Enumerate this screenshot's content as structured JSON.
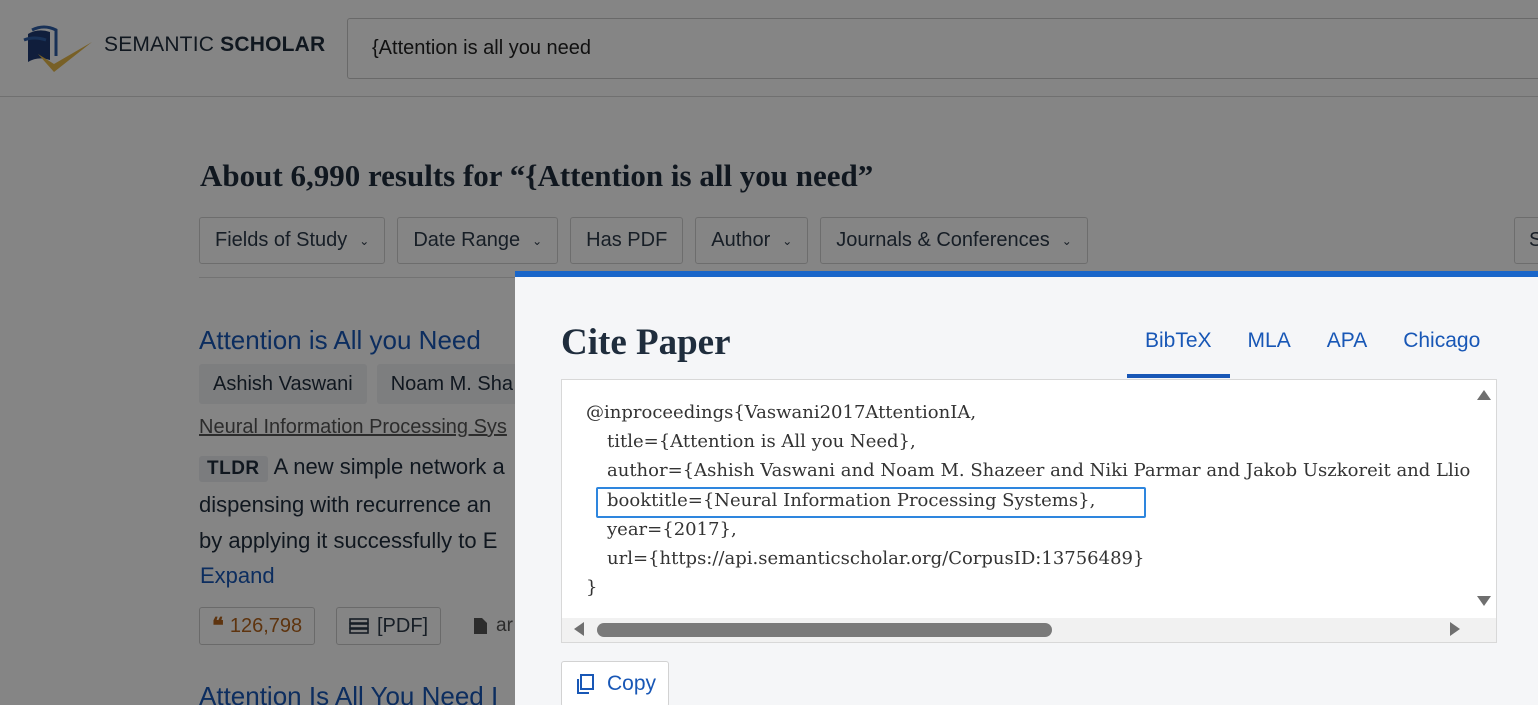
{
  "header": {
    "logo_text_light": "SEMANTIC ",
    "logo_text_bold": "SCHOLAR",
    "search_value": "{Attention is all you need"
  },
  "results": {
    "heading": "About 6,990 results for “{Attention is all you need”",
    "filters": {
      "fields_of_study": "Fields of Study",
      "date_range": "Date Range",
      "has_pdf": "Has PDF",
      "author": "Author",
      "journals": "Journals & Conferences",
      "partial_right": "S"
    },
    "paper1": {
      "title": "Attention is All you Need",
      "author1": "Ashish Vaswani",
      "author2": "Noam M. Sha",
      "venue": "Neural Information Processing Sys",
      "tldr_badge": "TLDR",
      "tldr_line1": "A new simple network a",
      "tldr_line2": "dispensing with recurrence an",
      "tldr_line3": "by applying it successfully to E",
      "expand": "Expand",
      "citations": "126,798",
      "pdf_label": "[PDF]",
      "arxiv_partial": "ar"
    },
    "paper2": {
      "title": "Attention Is All You Need I"
    }
  },
  "modal": {
    "title": "Cite Paper",
    "tabs": {
      "bibtex": "BibTeX",
      "mla": "MLA",
      "apa": "APA",
      "chicago": "Chicago"
    },
    "active_tab": "BibTeX",
    "bibtex_lines": {
      "l1": "@inproceedings{Vaswani2017AttentionIA,",
      "l2": "title={Attention is All you Need},",
      "l3": "author={Ashish Vaswani and Noam M. Shazeer and Niki Parmar and Jakob Uszkoreit and Llion Jones and Aidan N. Gomez and Lukasz Kaiser and Illia Polosukhin},",
      "l4": "booktitle={Neural Information Processing Systems},",
      "l5": "year={2017},",
      "l6": "url={https://api.semanticscholar.org/CorpusID:13756489}",
      "l7": "}"
    },
    "copy_label": "Copy"
  },
  "colors": {
    "accent": "#1857b6",
    "modal_top_border": "#1a66c9",
    "highlight_border": "#2e86de",
    "citation_count": "#b5651d"
  },
  "icons": {
    "logo": "semantic-scholar-logo",
    "chevron": "chevron-down-icon",
    "quote": "quote-icon",
    "pdf": "pdf-stack-icon",
    "file": "file-icon",
    "copy": "copy-icon"
  }
}
